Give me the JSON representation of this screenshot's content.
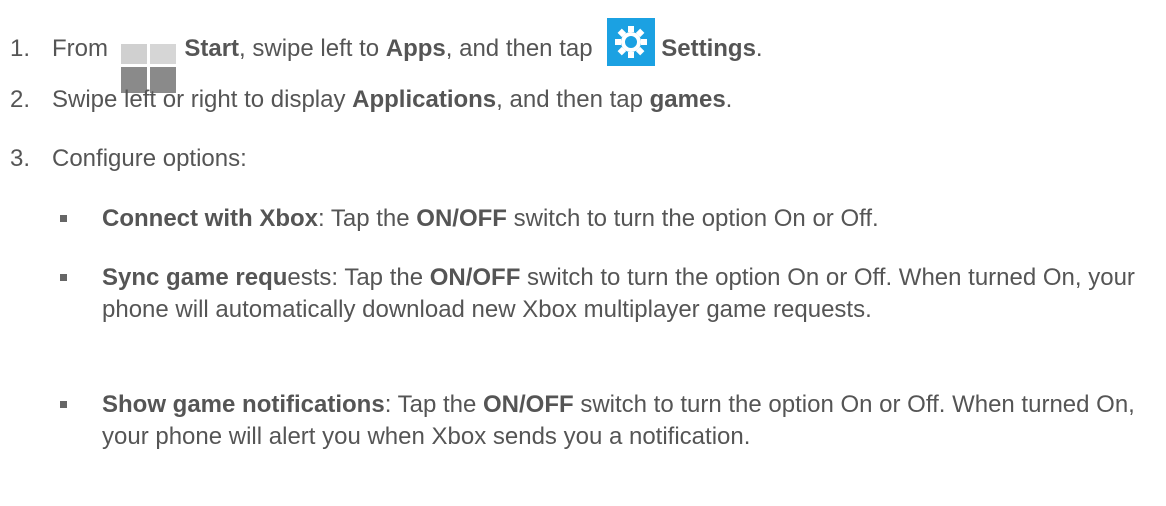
{
  "steps": [
    {
      "number": "1.",
      "text_from": "From ",
      "start_label": "Start",
      "text_swipe": ", swipe left to ",
      "apps_label": "Apps",
      "text_tap": ", and then tap ",
      "settings_label": "Settings",
      "end": ".",
      "icons": [
        "windows-start-icon",
        "settings-gear-icon"
      ]
    },
    {
      "number": "2.",
      "text_a": "Swipe left or right to display ",
      "applications_label": "Applications",
      "text_b": ", and then tap ",
      "games_label": "games",
      "end": "."
    },
    {
      "number": "3.",
      "text": "Configure options:"
    }
  ],
  "options": [
    {
      "title": "Connect with Xbox",
      "text_a": ": Tap the ",
      "switch_label": "ON/OFF",
      "text_b": " switch to turn the option On or Off."
    },
    {
      "title": "Sync game requ",
      "title_rest": "ests",
      "text_a": ": Tap the ",
      "switch_label": "ON/OFF",
      "text_b": " switch to turn the option On or Off. When turned On, your phone will automatically download new Xbox multiplayer game requests."
    },
    {
      "title": "Show game notifications",
      "text_a": ": Tap the ",
      "switch_label": "ON/OFF",
      "text_b": " switch to turn the option On or Off. When turned On, your phone will alert you when Xbox sends you a notification."
    }
  ],
  "colors": {
    "text": "#555555",
    "settings_tile": "#1ba1e2",
    "start_icon": "#8c8c8c"
  }
}
